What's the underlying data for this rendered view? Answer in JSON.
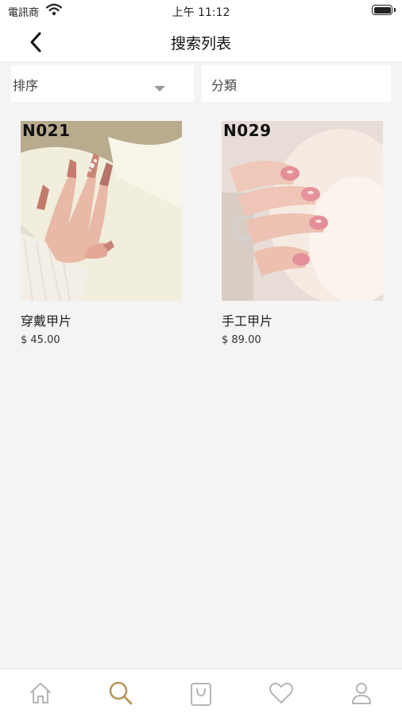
{
  "status_bar": {
    "carrier": "電訊商",
    "time": "上午 11:12"
  },
  "nav": {
    "title": "搜索列表"
  },
  "filters": {
    "sort_label": "排序",
    "category_label": "分類"
  },
  "products": [
    {
      "code": "N021",
      "name": "穿戴甲片",
      "price": "$ 45.00"
    },
    {
      "code": "N029",
      "name": "手工甲片",
      "price": "$ 89.00"
    }
  ],
  "tabs": [
    {
      "id": "home",
      "icon": "home-icon",
      "active": false
    },
    {
      "id": "search",
      "icon": "search-icon",
      "active": true
    },
    {
      "id": "bag",
      "icon": "shopping-bag-icon",
      "active": false
    },
    {
      "id": "favorites",
      "icon": "heart-icon",
      "active": false
    },
    {
      "id": "profile",
      "icon": "user-icon",
      "active": false
    }
  ],
  "colors": {
    "active_tab": "#b8965a",
    "inactive_tab": "#b5b5b5",
    "background": "#f4f4f4"
  }
}
